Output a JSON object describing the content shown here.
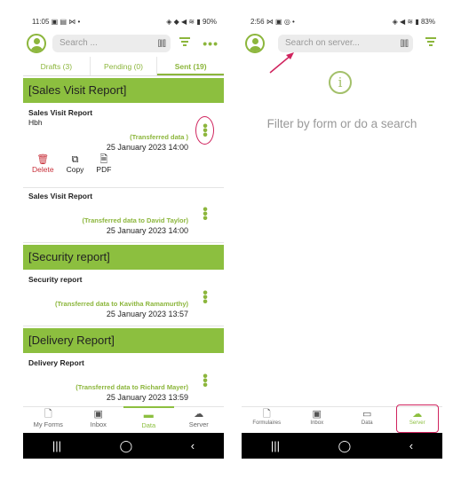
{
  "left": {
    "status": {
      "time": "11:05",
      "icons": "▣ ▤ ⋈ •",
      "right": "90%"
    },
    "search_placeholder": "Search ...",
    "tabs": [
      {
        "label": "Drafts (3)"
      },
      {
        "label": "Pending (0)"
      },
      {
        "label": "Sent (19)",
        "active": true
      }
    ],
    "groups": [
      {
        "banner": "[Sales Visit Report]",
        "items": [
          {
            "title": "Sales Visit Report",
            "subtitle": "Hbh",
            "status": "(Transferred data )",
            "date": "25 January 2023 14:00",
            "actions": [
              {
                "label": "Delete",
                "icon": "trash-icon"
              },
              {
                "label": "Copy",
                "icon": "copy-icon"
              },
              {
                "label": "PDF",
                "icon": "pdf-icon"
              }
            ]
          },
          {
            "title": "Sales Visit Report",
            "status": "(Transferred data to David Taylor)",
            "date": "25 January 2023 14:00"
          }
        ]
      },
      {
        "banner": "[Security report]",
        "items": [
          {
            "title": "Security report",
            "status": "(Transferred data to Kavitha Ramamurthy)",
            "date": "25 January 2023 13:57"
          }
        ]
      },
      {
        "banner": "[Delivery Report]",
        "items": [
          {
            "title": "Delivery Report",
            "status": "(Transferred data to Richard Mayer)",
            "date": "25 January 2023 13:59"
          }
        ]
      }
    ],
    "nav": [
      {
        "label": "My Forms",
        "icon": "form-icon"
      },
      {
        "label": "Inbox",
        "icon": "inbox-icon"
      },
      {
        "label": "Data",
        "icon": "data-icon",
        "active": true
      },
      {
        "label": "Server",
        "icon": "cloud-search-icon"
      }
    ]
  },
  "right": {
    "status": {
      "time": "2:56",
      "icons": "⋈ ▣ ◎ •",
      "right": "83%"
    },
    "search_placeholder": "Search on server...",
    "empty_message": "Filter by form or do a search",
    "nav": [
      {
        "label": "Formulaires",
        "icon": "form-icon"
      },
      {
        "label": "Inbox",
        "icon": "inbox-icon"
      },
      {
        "label": "Data",
        "icon": "data-icon"
      },
      {
        "label": "Server",
        "icon": "cloud-search-icon",
        "active": true
      }
    ]
  },
  "colors": {
    "accent": "#8cbf3f",
    "highlight": "#d0245e"
  }
}
